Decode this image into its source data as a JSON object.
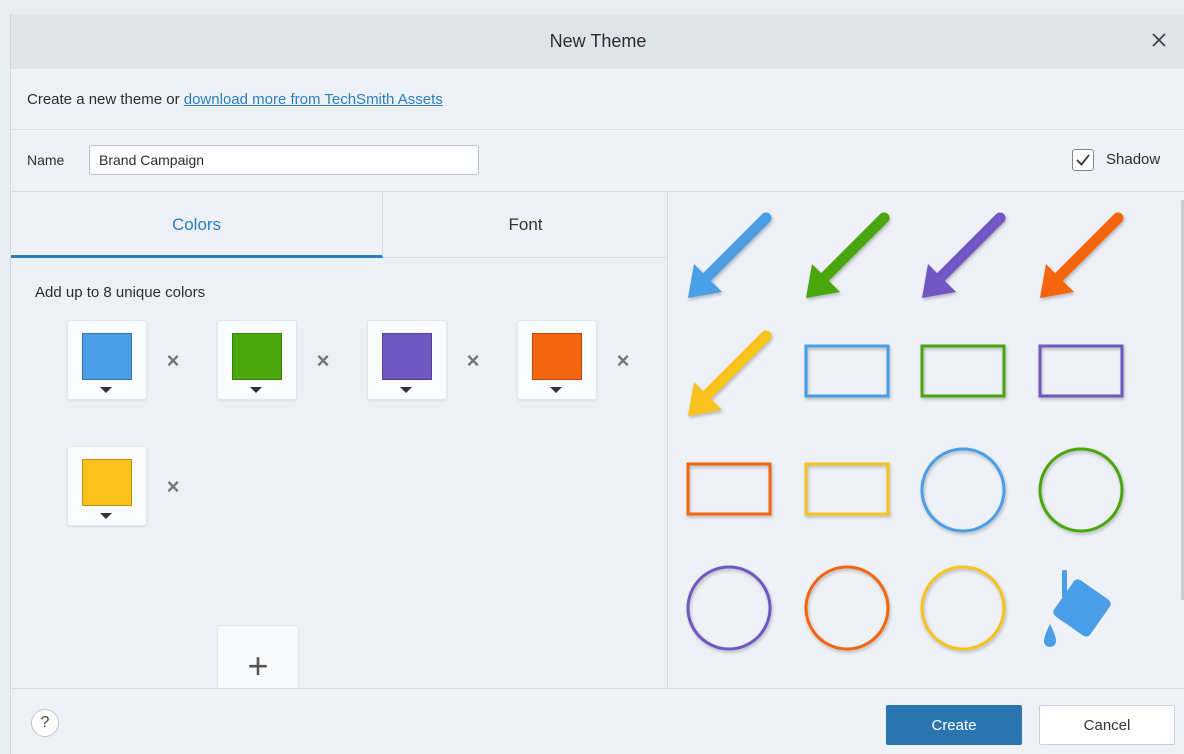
{
  "dialog": {
    "title": "New Theme",
    "close_icon": "close-icon"
  },
  "intro": {
    "text": "Create a new theme or ",
    "link": "download more from TechSmith Assets"
  },
  "name_row": {
    "label": "Name",
    "value": "Brand Campaign",
    "shadow_label": "Shadow",
    "shadow_checked": true
  },
  "tabs": [
    {
      "label": "Colors",
      "active": true
    },
    {
      "label": "Font",
      "active": false
    }
  ],
  "colors_hint": "Add up to 8 unique colors",
  "colors": [
    "#4a9ee8",
    "#4aa70e",
    "#7157c4",
    "#f46511",
    "#f8c21a"
  ],
  "add_color_icon": "plus-icon",
  "preview": {
    "arrows": [
      "#4a9ee8",
      "#4aa70e",
      "#7157c4",
      "#f46511",
      "#f8c21a"
    ],
    "rectangles": [
      "#4a9ee8",
      "#4aa70e",
      "#7157c4",
      "#f46511",
      "#f8c21a"
    ],
    "ellipses": [
      "#4a9ee8",
      "#4aa70e",
      "#7157c4",
      "#f46511",
      "#f8c21a"
    ],
    "fill_icon": "paint-bucket-icon"
  },
  "footer": {
    "help": "?",
    "create_label": "Create",
    "cancel_label": "Cancel"
  }
}
